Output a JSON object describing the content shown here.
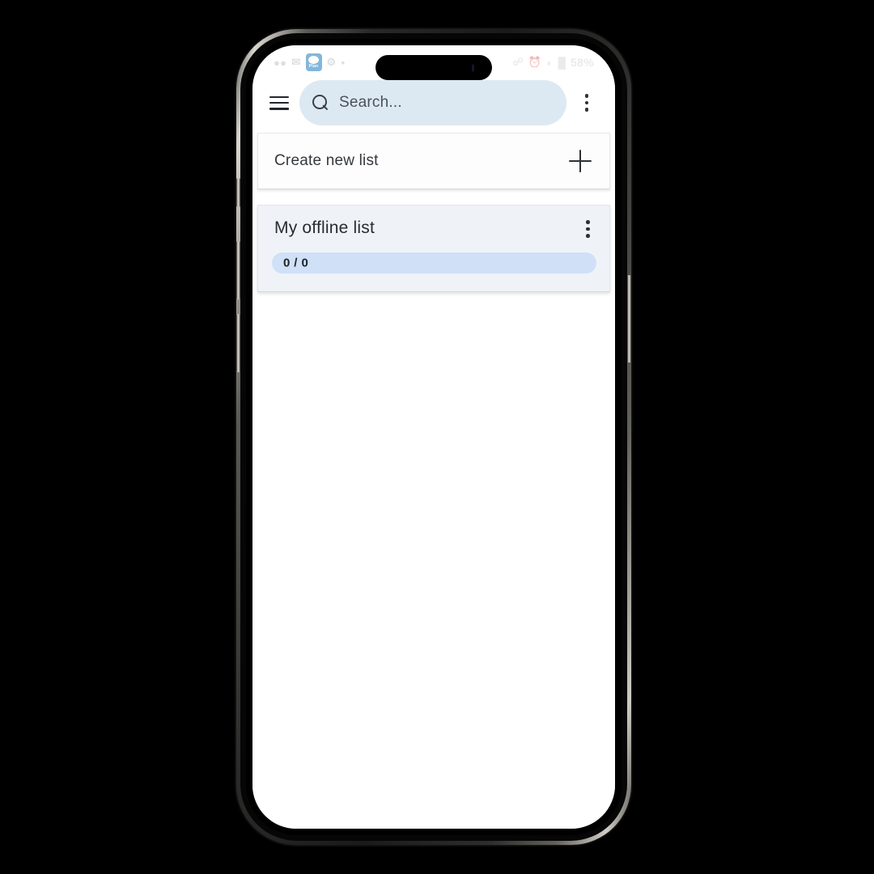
{
  "device": {
    "name": "smartphone-frame",
    "buttons": [
      "silence-switch",
      "volume-up",
      "volume-down",
      "power-button"
    ]
  },
  "status_bar": {
    "left_icons": [
      "notification-glyph",
      "mail-icon",
      "app-badge-icon",
      "settings-icon",
      "dot-icon"
    ],
    "app_badge_label": "Plan",
    "right_icons": [
      "bluetooth-icon",
      "alarm-icon",
      "wifi-icon",
      "signal-icon"
    ],
    "battery": "58%"
  },
  "appbar": {
    "menu_icon": "hamburger-menu-icon",
    "overflow_icon": "more-vertical-icon",
    "search": {
      "icon": "search-icon",
      "placeholder": "Search...",
      "value": ""
    }
  },
  "content": {
    "create_new": {
      "label": "Create new list",
      "add_icon": "plus-icon"
    },
    "lists": [
      {
        "title": "My offline list",
        "menu_icon": "more-vertical-icon",
        "progress_label": "0 / 0",
        "completed": 0,
        "total": 0,
        "percent": 0
      }
    ]
  },
  "colors": {
    "search_background": "#dde9f2",
    "card_background": "#eff3f8",
    "progress_track": "#cfe0f7",
    "progress_fill": "#7fb0e8",
    "text_primary": "#272c31",
    "accent": "#1f7cc0"
  }
}
